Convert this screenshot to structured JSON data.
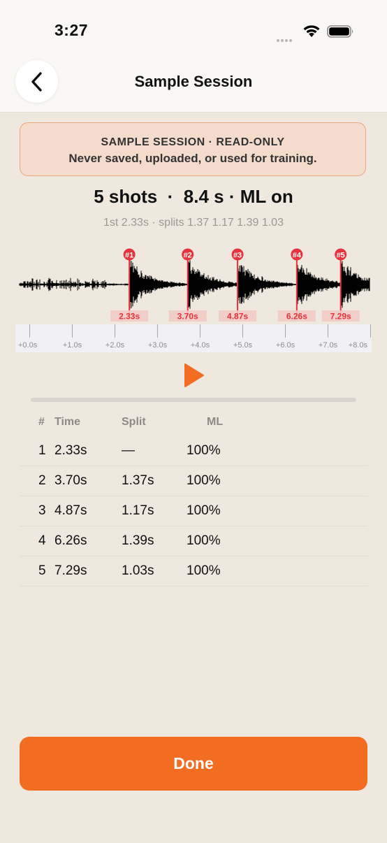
{
  "status_bar": {
    "time": "3:27"
  },
  "nav": {
    "title": "Sample Session"
  },
  "banner": {
    "title": "SAMPLE SESSION · READ-ONLY",
    "subtitle": "Never saved, uploaded, or used for training."
  },
  "summary": {
    "headline": "5 shots  ·  8.4 s · ML on",
    "splits_line": "1st 2.33s · splits 1.37 1.17 1.39 1.03"
  },
  "waveform": {
    "duration_s": 8.4,
    "shots": [
      {
        "tag": "#1",
        "time": 2.33,
        "label": "2.33s"
      },
      {
        "tag": "#2",
        "time": 3.7,
        "label": "3.70s"
      },
      {
        "tag": "#3",
        "time": 4.87,
        "label": "4.87s"
      },
      {
        "tag": "#4",
        "time": 6.26,
        "label": "6.26s"
      },
      {
        "tag": "#5",
        "time": 7.29,
        "label": "7.29s"
      }
    ],
    "ticks": [
      "+0.0s",
      "+1.0s",
      "+2.0s",
      "+3.0s",
      "+4.0s",
      "+5.0s",
      "+6.0s",
      "+7.0s",
      "+8.0s"
    ],
    "accent_color": "#E8323C",
    "wave_color": "#000000"
  },
  "player": {
    "play_icon": "play-icon",
    "progress": 0,
    "accent_color": "#F26C21"
  },
  "table": {
    "headers": {
      "num": "#",
      "time": "Time",
      "split": "Split",
      "ml": "ML"
    },
    "rows": [
      {
        "num": "1",
        "time": "2.33s",
        "split": "—",
        "ml": "100%"
      },
      {
        "num": "2",
        "time": "3.70s",
        "split": "1.37s",
        "ml": "100%"
      },
      {
        "num": "3",
        "time": "4.87s",
        "split": "1.17s",
        "ml": "100%"
      },
      {
        "num": "4",
        "time": "6.26s",
        "split": "1.39s",
        "ml": "100%"
      },
      {
        "num": "5",
        "time": "7.29s",
        "split": "1.03s",
        "ml": "100%"
      }
    ]
  },
  "done_button": {
    "label": "Done",
    "color": "#F26C21"
  }
}
